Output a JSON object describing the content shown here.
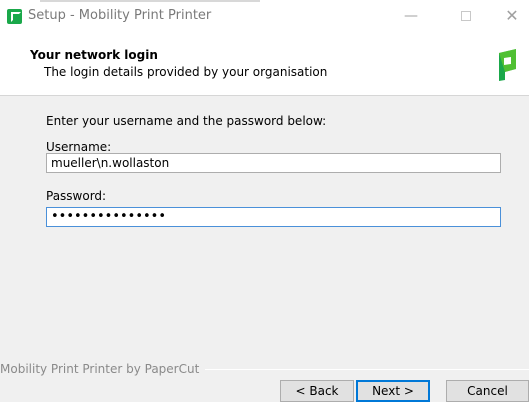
{
  "window": {
    "title": "Setup - Mobility Print Printer"
  },
  "header": {
    "title": "Your network login",
    "subtitle": "The login details provided by your organisation"
  },
  "form": {
    "instruction": "Enter your username and the password below:",
    "username_label": "Username:",
    "username_value": "mueller\\n.wollaston",
    "password_label": "Password:",
    "password_mask": "•••••••••••••••"
  },
  "footer": {
    "brand": "Mobility Print Printer by PaperCut",
    "back_label": "< Back",
    "next_label": "Next >",
    "cancel_label": "Cancel"
  },
  "colors": {
    "brand_green": "#1aa84a",
    "focus_blue": "#0078d7"
  },
  "icons": {
    "app": "papercut-app-icon",
    "logo": "papercut-logo-icon",
    "minimize": "minimize-icon",
    "maximize": "maximize-icon",
    "close": "close-icon"
  }
}
